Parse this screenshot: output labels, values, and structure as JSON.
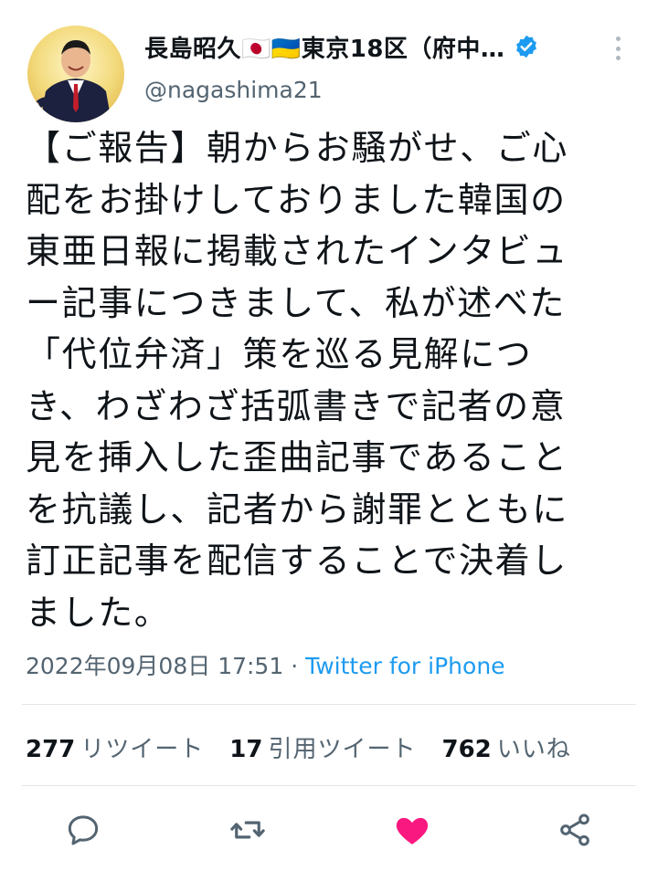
{
  "user": {
    "display_name": "長島昭久🇯🇵🇺🇦東京18区（府中…",
    "handle": "@nagashima21",
    "verified": true
  },
  "tweet": {
    "text": "【ご報告】朝からお騒がせ、ご心\n配をお掛けしておりました韓国の\n東亜日報に掲載されたインタビュ\nー記事につきまして、私が述べた\n「代位弁済」策を巡る見解につ\nき、わざわざ括弧書きで記者の意\n見を挿入した歪曲記事であること\nを抗議し、記者から謝罪とともに\n訂正記事を配信することで決着し\nました。",
    "timestamp": "2022年09月08日 17:51",
    "separator": " · ",
    "source": "Twitter for iPhone"
  },
  "stats": {
    "retweets": {
      "count": "277",
      "label": "リツイート"
    },
    "quotes": {
      "count": "17",
      "label": "引用ツイート"
    },
    "likes": {
      "count": "762",
      "label": "いいね"
    }
  },
  "actions": {
    "reply": "reply-icon",
    "retweet": "retweet-icon",
    "like": "heart-icon",
    "share": "share-icon",
    "liked": true,
    "like_color": "#f91880",
    "accent_color": "#1d9bf0",
    "icon_color": "#536471"
  }
}
